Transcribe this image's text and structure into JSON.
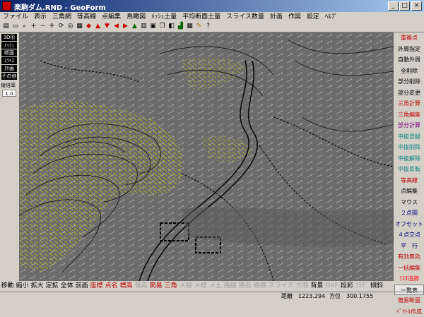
{
  "window": {
    "title": "楽駒ダム.RND - GeoForm",
    "controls": [
      "_",
      "□",
      "×"
    ]
  },
  "menu": [
    "ファイル",
    "表示",
    "三角網",
    "等高線",
    "点編集",
    "鳥瞰図",
    "ﾒｯｼｭ土量",
    "平均断面土量",
    "スライス数量",
    "計画",
    "作図",
    "設定",
    "ﾍﾙﾌﾟ"
  ],
  "left_panel": {
    "buttons": [
      "3D形",
      "ﾒｯｼｭ",
      "断面",
      "ｽﾗｲｽ",
      "計画",
      "その他"
    ],
    "zoom_label": "縦倍率",
    "zoom_value": "1.0"
  },
  "right_panel": [
    {
      "label": "重複点",
      "color": "#c00000"
    },
    {
      "label": "外周指定",
      "color": "#000000"
    },
    {
      "label": "自動外周",
      "color": "#000000"
    },
    {
      "label": "全削除",
      "color": "#000000"
    },
    {
      "label": "部分削除",
      "color": "#000000"
    },
    {
      "label": "部分変更",
      "color": "#000000"
    },
    {
      "label": "三角計算",
      "color": "#c00000"
    },
    {
      "label": "三角編集",
      "color": "#c00000"
    },
    {
      "label": "部分計算",
      "color": "#800080"
    },
    {
      "label": "中抜登録",
      "color": "#008080"
    },
    {
      "label": "中抜削除",
      "color": "#008080"
    },
    {
      "label": "中抜解除",
      "color": "#008080"
    },
    {
      "label": "中抜反転",
      "color": "#008080"
    },
    {
      "label": "等高線",
      "color": "#c00000"
    },
    {
      "label": "点編集",
      "color": "#000000"
    },
    {
      "label": "マウス",
      "color": "#000000"
    },
    {
      "label": "２点間",
      "color": "#000080"
    },
    {
      "label": "オフセット",
      "color": "#000080"
    },
    {
      "label": "４点交点",
      "color": "#000080"
    },
    {
      "label": "平　行",
      "color": "#000080"
    },
    {
      "label": "有効無効",
      "color": "#c00000"
    },
    {
      "label": "一括編集",
      "color": "#c00000"
    },
    {
      "label": "ﾗｽﾀ追跡",
      "color": "#ff0000"
    },
    {
      "label": "一覧表",
      "color": "#000000"
    },
    {
      "label": "簡易断面",
      "color": "#c00000"
    },
    {
      "label": "ﾍﾞｸﾄﾙ作成",
      "color": "#c00000"
    }
  ],
  "bottom_bar": [
    {
      "label": "移動",
      "color": "#000000"
    },
    {
      "label": "縮小",
      "color": "#000000"
    },
    {
      "label": "拡大",
      "color": "#000000"
    },
    {
      "label": "定拡",
      "color": "#000000"
    },
    {
      "label": "全体",
      "color": "#000000"
    },
    {
      "label": "前画",
      "color": "#000000"
    },
    {
      "label": "座標",
      "color": "#c00000"
    },
    {
      "label": "点名",
      "color": "#c00000"
    },
    {
      "label": "標高",
      "color": "#c00000"
    },
    {
      "label": "等高",
      "color": "#a0a0a0"
    },
    {
      "label": "簡易",
      "color": "#c00000"
    },
    {
      "label": "三角",
      "color": "#c00000"
    },
    {
      "label": "メ線",
      "color": "#a0a0a0"
    },
    {
      "label": "メ標",
      "color": "#a0a0a0"
    },
    {
      "label": "メ土",
      "color": "#a0a0a0"
    },
    {
      "label": "路線",
      "color": "#a0a0a0"
    },
    {
      "label": "路名",
      "color": "#a0a0a0"
    },
    {
      "label": "路横",
      "color": "#a0a0a0"
    },
    {
      "label": "スライス",
      "color": "#a0a0a0"
    },
    {
      "label": "方眼",
      "color": "#a0a0a0"
    },
    {
      "label": "背景",
      "color": "#000000"
    },
    {
      "label": "DXF",
      "color": "#a0a0a0"
    },
    {
      "label": "段彩",
      "color": "#000000"
    },
    {
      "label": "ﾌﾗｸﾞ",
      "color": "#a0a0a0"
    },
    {
      "label": "傾斜",
      "color": "#000000"
    }
  ],
  "status": {
    "distance_label": "距離",
    "distance_value": "1223.294",
    "bearing_label": "方位",
    "bearing_value": "300.1755"
  }
}
